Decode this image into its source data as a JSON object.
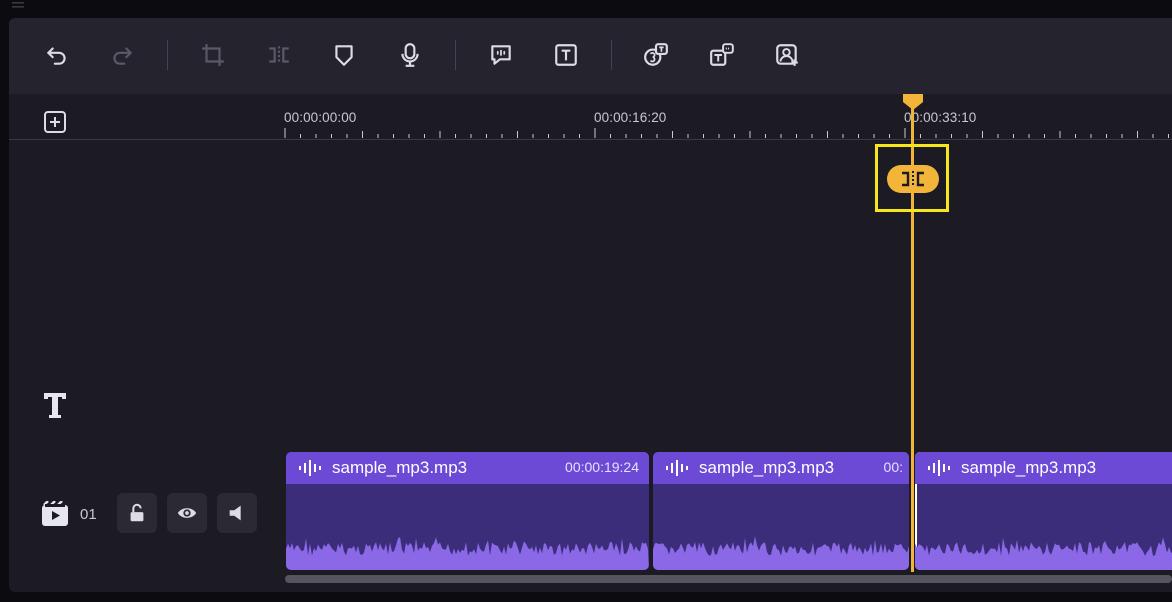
{
  "toolbar": {
    "buttons": [
      {
        "name": "undo",
        "icon": "undo-icon",
        "enabled": true
      },
      {
        "name": "redo",
        "icon": "redo-icon",
        "enabled": false
      },
      {
        "name": "crop",
        "icon": "crop-icon",
        "enabled": false
      },
      {
        "name": "split",
        "icon": "split-icon",
        "enabled": false
      },
      {
        "name": "marker",
        "icon": "marker-icon",
        "enabled": true
      },
      {
        "name": "voiceover",
        "icon": "microphone-icon",
        "enabled": true
      },
      {
        "name": "speech-to-text",
        "icon": "speech-bubble-icon",
        "enabled": true
      },
      {
        "name": "text",
        "icon": "text-icon",
        "enabled": true
      },
      {
        "name": "auto-subtitle",
        "icon": "subtitle-icon",
        "enabled": true
      },
      {
        "name": "text-to-speech",
        "icon": "text-speech-icon",
        "enabled": true
      },
      {
        "name": "portrait",
        "icon": "portrait-icon",
        "enabled": true
      }
    ]
  },
  "ruler": {
    "timecodes": [
      "00:00:00:00",
      "00:00:16:20",
      "00:00:33:10"
    ]
  },
  "tracks": {
    "text_track_icon": "text-track-icon",
    "media_track": {
      "number": "01",
      "controls": [
        "lock-icon",
        "eye-icon",
        "speaker-icon"
      ]
    }
  },
  "clips": [
    {
      "name": "sample_mp3.mp3",
      "duration": "00:00:19:24",
      "selected": false
    },
    {
      "name": "sample_mp3.mp3",
      "duration": "00:",
      "selected": false
    },
    {
      "name": "sample_mp3.mp3",
      "duration": "",
      "selected": true
    }
  ],
  "playhead": {
    "timecode_reference": "00:00:33:10",
    "split_button_icon": "split-icon"
  },
  "colors": {
    "accent": "#f3b43a",
    "highlight": "#f6e61a",
    "clip_header": "#6c4ad6",
    "clip_body": "#3c2d7a",
    "waveform": "#8a68e6"
  }
}
